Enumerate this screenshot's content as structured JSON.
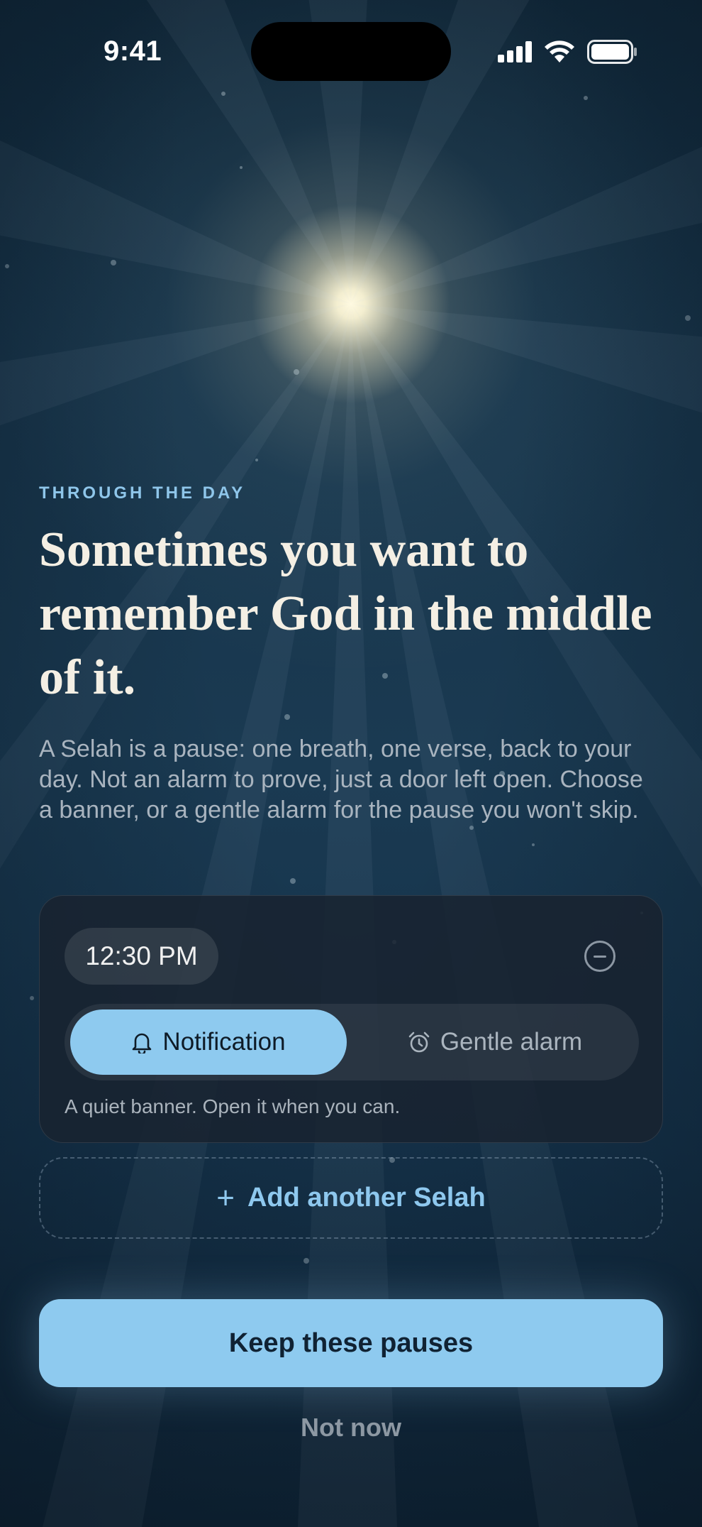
{
  "status_bar": {
    "time": "9:41"
  },
  "onboarding": {
    "eyebrow": "THROUGH THE DAY",
    "headline": "Sometimes you want to remember God in the middle of it.",
    "body": "A Selah is a pause: one breath, one verse, back to your day. Not an alarm to prove, just a door left open. Choose a banner, or a gentle alarm for the pause you won't skip."
  },
  "selah_card": {
    "time": "12:30 PM",
    "remove_icon": "minus-circle-icon",
    "modes": [
      {
        "label": "Notification",
        "icon": "bell-icon",
        "selected": true
      },
      {
        "label": "Gentle alarm",
        "icon": "alarm-clock-icon",
        "selected": false
      }
    ],
    "note": "A quiet banner. Open it when you can."
  },
  "add_selah": {
    "icon": "plus-icon",
    "label": "Add another Selah"
  },
  "actions": {
    "primary_label": "Keep these pauses",
    "secondary_label": "Not now"
  },
  "colors": {
    "accent": "#8ecaef",
    "eyebrow": "#8fc6ea",
    "background_top": "#0f2536",
    "background_bottom": "#0e2233",
    "card": "#182330"
  }
}
